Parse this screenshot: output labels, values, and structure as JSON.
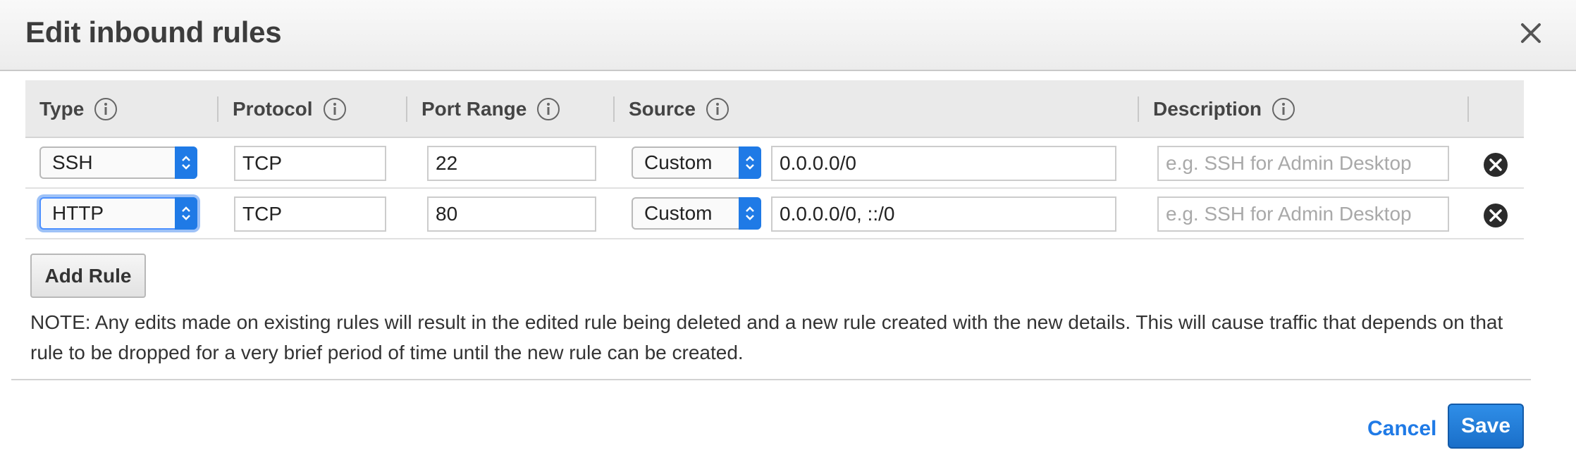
{
  "dialog": {
    "title": "Edit inbound rules"
  },
  "table": {
    "headers": {
      "type": "Type",
      "protocol": "Protocol",
      "port_range": "Port Range",
      "source": "Source",
      "description": "Description"
    },
    "rows": [
      {
        "type": "SSH",
        "protocol": "TCP",
        "port_range": "22",
        "source_type": "Custom",
        "source": "0.0.0.0/0",
        "description_placeholder": "e.g. SSH for Admin Desktop"
      },
      {
        "type": "HTTP",
        "protocol": "TCP",
        "port_range": "80",
        "source_type": "Custom",
        "source": "0.0.0.0/0, ::/0",
        "description_placeholder": "e.g. SSH for Admin Desktop"
      }
    ]
  },
  "actions": {
    "add_rule": "Add Rule",
    "cancel": "Cancel",
    "save": "Save"
  },
  "note": "NOTE: Any edits made on existing rules will result in the edited rule being deleted and a new rule created with the new details. This will cause traffic that depends on that rule to be dropped for a very brief period of time until the new rule can be created.",
  "icons": {
    "close": "close-icon",
    "info": "info-icon",
    "remove": "remove-circle-icon",
    "select_caret": "chevron-up-down-icon"
  },
  "colors": {
    "accent": "#1f7ae6",
    "focus_ring": "#4d90fe"
  }
}
